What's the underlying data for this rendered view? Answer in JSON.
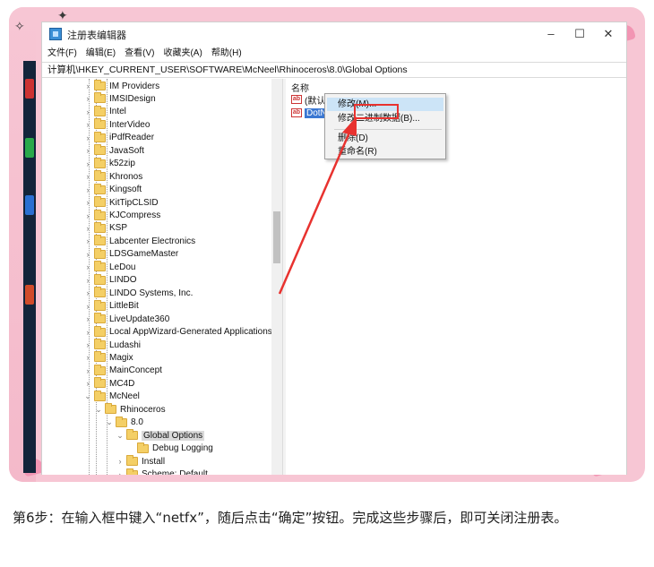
{
  "window": {
    "title": "注册表编辑器",
    "minimize": "–",
    "maximize": "☐",
    "close": "✕"
  },
  "menu": [
    "文件(F)",
    "编辑(E)",
    "查看(V)",
    "收藏夹(A)",
    "帮助(H)"
  ],
  "address": "计算机\\HKEY_CURRENT_USER\\SOFTWARE\\McNeel\\Rhinoceros\\8.0\\Global Options",
  "tree": {
    "items": [
      {
        "label": "IM Providers",
        "level": 0,
        "chevron": "›",
        "selected": false
      },
      {
        "label": "IMSIDesign",
        "level": 0,
        "chevron": "›",
        "selected": false
      },
      {
        "label": "Intel",
        "level": 0,
        "chevron": "›",
        "selected": false
      },
      {
        "label": "InterVideo",
        "level": 0,
        "chevron": "›",
        "selected": false
      },
      {
        "label": "iPdfReader",
        "level": 0,
        "chevron": "›",
        "selected": false
      },
      {
        "label": "JavaSoft",
        "level": 0,
        "chevron": "›",
        "selected": false
      },
      {
        "label": "k52zip",
        "level": 0,
        "chevron": "›",
        "selected": false
      },
      {
        "label": "Khronos",
        "level": 0,
        "chevron": "›",
        "selected": false
      },
      {
        "label": "Kingsoft",
        "level": 0,
        "chevron": "›",
        "selected": false
      },
      {
        "label": "KitTipCLSID",
        "level": 0,
        "chevron": "›",
        "selected": false
      },
      {
        "label": "KJCompress",
        "level": 0,
        "chevron": "›",
        "selected": false
      },
      {
        "label": "KSP",
        "level": 0,
        "chevron": "›",
        "selected": false
      },
      {
        "label": "Labcenter Electronics",
        "level": 0,
        "chevron": "›",
        "selected": false
      },
      {
        "label": "LDSGameMaster",
        "level": 0,
        "chevron": "›",
        "selected": false
      },
      {
        "label": "LeDou",
        "level": 0,
        "chevron": "›",
        "selected": false
      },
      {
        "label": "LINDO",
        "level": 0,
        "chevron": "›",
        "selected": false
      },
      {
        "label": "LINDO Systems, Inc.",
        "level": 0,
        "chevron": "›",
        "selected": false
      },
      {
        "label": "LittleBit",
        "level": 0,
        "chevron": "›",
        "selected": false
      },
      {
        "label": "LiveUpdate360",
        "level": 0,
        "chevron": "›",
        "selected": false
      },
      {
        "label": "Local AppWizard-Generated Applications",
        "level": 0,
        "chevron": "›",
        "selected": false
      },
      {
        "label": "Ludashi",
        "level": 0,
        "chevron": "›",
        "selected": false
      },
      {
        "label": "Magix",
        "level": 0,
        "chevron": "›",
        "selected": false
      },
      {
        "label": "MainConcept",
        "level": 0,
        "chevron": "›",
        "selected": false
      },
      {
        "label": "MC4D",
        "level": 0,
        "chevron": "›",
        "selected": false
      },
      {
        "label": "McNeel",
        "level": 0,
        "chevron": "⌄",
        "selected": false
      },
      {
        "label": "Rhinoceros",
        "level": 1,
        "chevron": "⌄",
        "selected": false
      },
      {
        "label": "8.0",
        "level": 2,
        "chevron": "⌄",
        "selected": false
      },
      {
        "label": "Global Options",
        "level": 3,
        "chevron": "⌄",
        "selected": true
      },
      {
        "label": "Debug Logging",
        "level": 4,
        "chevron": "",
        "selected": false
      },
      {
        "label": "Install",
        "level": 3,
        "chevron": "›",
        "selected": false
      },
      {
        "label": "Scheme: Default",
        "level": 3,
        "chevron": "›",
        "selected": false
      }
    ]
  },
  "values": {
    "header": "名称",
    "rows": [
      {
        "icon": "ab",
        "label": "(默认)",
        "selected": false
      },
      {
        "icon": "ab",
        "label": "DotNetRuntime",
        "selected": true
      }
    ]
  },
  "context_menu": {
    "items": [
      "修改(M)...",
      "修改二进制数据(B)...",
      "删除(D)",
      "重命名(R)"
    ]
  },
  "caption": "第6步：在输入框中键入“netfx”，随后点击“确定”按钮。完成这些步骤后，即可关闭注册表。",
  "colors": {
    "frame": "#f7c6d4",
    "highlight": "#e8322f",
    "selection": "#3a77d2"
  }
}
